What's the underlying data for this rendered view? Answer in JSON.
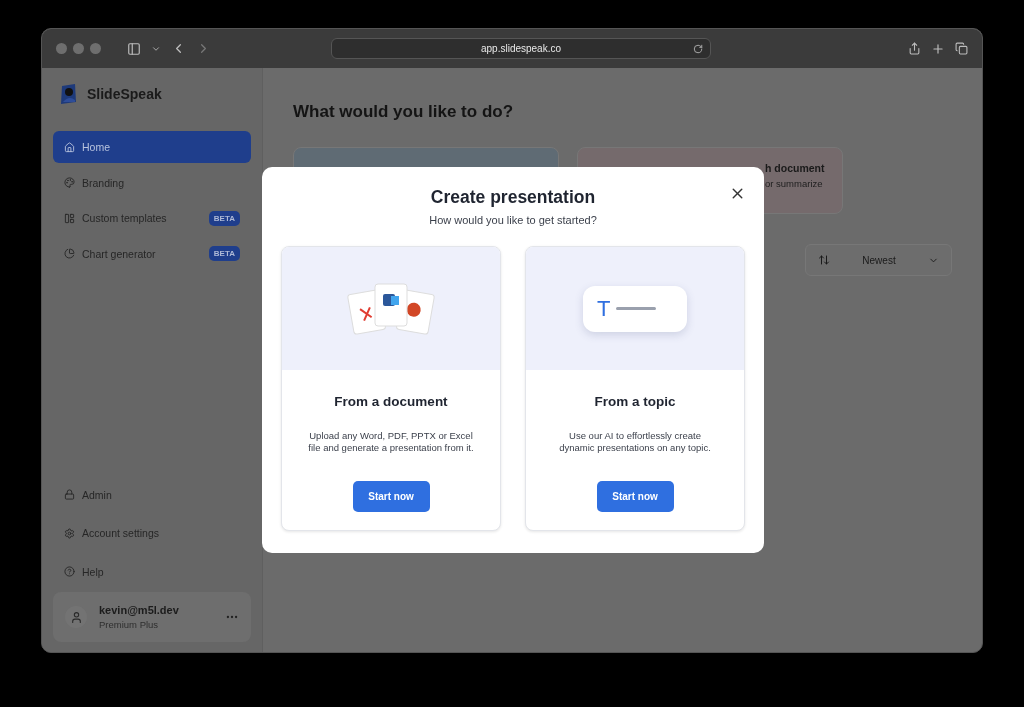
{
  "browser": {
    "url": "app.slidespeak.co"
  },
  "sidebar": {
    "brand": "SlideSpeak",
    "nav": [
      {
        "label": "Home",
        "selected": true
      },
      {
        "label": "Branding",
        "selected": false
      },
      {
        "label": "Custom templates",
        "selected": false,
        "badge": "BETA"
      },
      {
        "label": "Chart generator",
        "selected": false,
        "badge": "BETA"
      }
    ],
    "bottom_nav": [
      {
        "label": "Admin"
      },
      {
        "label": "Account settings"
      },
      {
        "label": "Help"
      }
    ],
    "user": {
      "email": "kevin@m5l.dev",
      "plan": "Premium Plus"
    }
  },
  "main": {
    "heading": "What would you like to do?",
    "cards": [
      {
        "color": "#5f6b74"
      },
      {
        "title": "h document",
        "description": "or summarize",
        "color": "#756a6c"
      }
    ],
    "sort": {
      "label": "Newest"
    }
  },
  "modal": {
    "title": "Create presentation",
    "subtitle": "How would you like to get started?",
    "options": [
      {
        "kind": "document",
        "title": "From a document",
        "description": "Upload any Word, PDF, PPTX or Excel file and generate a presentation from it.",
        "button": "Start now"
      },
      {
        "kind": "topic",
        "illustration_text": "T",
        "title": "From a topic",
        "description": "Use our AI to effortlessly create dynamic presentations on any topic.",
        "button": "Start now"
      }
    ]
  }
}
